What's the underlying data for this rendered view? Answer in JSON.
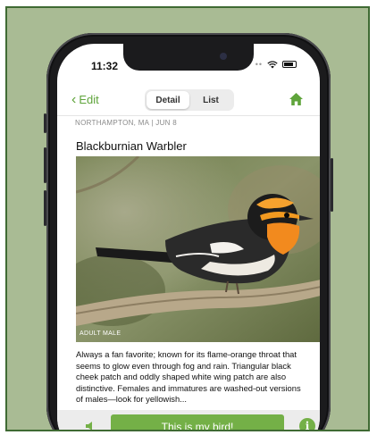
{
  "status": {
    "time": "11:32"
  },
  "nav": {
    "back_label": "Edit",
    "tabs": [
      {
        "label": "Detail",
        "active": true
      },
      {
        "label": "List",
        "active": false
      }
    ],
    "home_icon": "home-icon"
  },
  "sighting": {
    "meta": "NORTHAMPTON, MA  |  JUN 8",
    "species_name": "Blackburnian Warbler",
    "photo_caption": "ADULT MALE",
    "description": "Always a fan favorite; known for its flame-orange throat that seems to glow even through fog and rain. Triangular black cheek patch and oddly shaped white wing patch are also distinctive. Females and immatures are washed-out versions of males—look for yellowish..."
  },
  "actions": {
    "sound_icon": "speaker-icon",
    "confirm_label": "This is my bird!",
    "info_icon": "info-icon",
    "info_glyph": "i"
  },
  "colors": {
    "accent_green": "#74b047",
    "nav_green": "#5fa43b",
    "frame_bg": "#a9bb94",
    "frame_border": "#3f6a33"
  }
}
